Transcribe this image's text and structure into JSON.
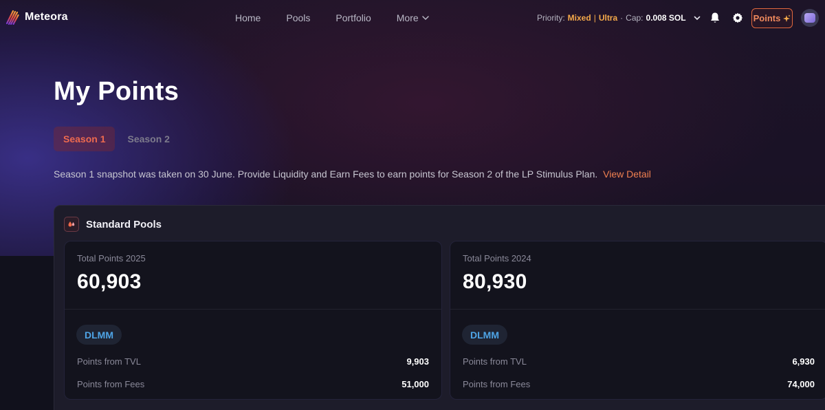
{
  "brand": {
    "name": "Meteora",
    "logo_icon": "meteora-logo-icon"
  },
  "nav": {
    "items": [
      "Home",
      "Pools",
      "Portfolio",
      "More"
    ],
    "more_icon": "chevron-down-icon"
  },
  "priority": {
    "label": "Priority:",
    "mode": "Mixed",
    "separator": "|",
    "level": "Ultra",
    "dot": "·",
    "cap_label": "Cap:",
    "cap_value": "0.008 SOL"
  },
  "header_actions": {
    "points_label": "Points",
    "points_icon": "sparkle-icon",
    "accent_color": "#e2683e"
  },
  "page": {
    "title": "My Points",
    "tabs": [
      {
        "label": "Season 1",
        "active": true
      },
      {
        "label": "Season 2",
        "active": false
      }
    ],
    "notice": "Season 1 snapshot was taken on 30 June. Provide Liquidity and Earn Fees to earn points for Season 2 of the LP Stimulus Plan.",
    "notice_link": "View Detail"
  },
  "panel": {
    "title": "Standard Pools",
    "icon": "drops-icon",
    "cards": [
      {
        "label": "Total Points 2025",
        "total": "60,903",
        "badge": "DLMM",
        "rows": [
          {
            "label": "Points from TVL",
            "value": "9,903"
          },
          {
            "label": "Points from Fees",
            "value": "51,000"
          }
        ]
      },
      {
        "label": "Total Points 2024",
        "total": "80,930",
        "badge": "DLMM",
        "rows": [
          {
            "label": "Points from TVL",
            "value": "6,930"
          },
          {
            "label": "Points from Fees",
            "value": "74,000"
          }
        ]
      }
    ]
  }
}
